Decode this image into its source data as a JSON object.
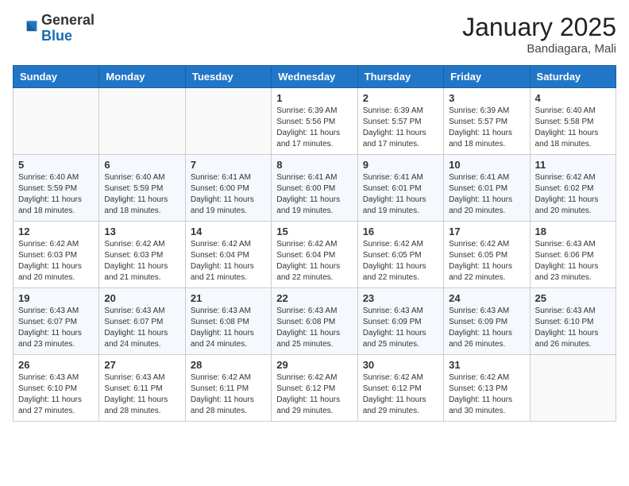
{
  "header": {
    "logo_general": "General",
    "logo_blue": "Blue",
    "month_title": "January 2025",
    "location": "Bandiagara, Mali"
  },
  "weekdays": [
    "Sunday",
    "Monday",
    "Tuesday",
    "Wednesday",
    "Thursday",
    "Friday",
    "Saturday"
  ],
  "weeks": [
    [
      {
        "day": "",
        "info": ""
      },
      {
        "day": "",
        "info": ""
      },
      {
        "day": "",
        "info": ""
      },
      {
        "day": "1",
        "info": "Sunrise: 6:39 AM\nSunset: 5:56 PM\nDaylight: 11 hours and 17 minutes."
      },
      {
        "day": "2",
        "info": "Sunrise: 6:39 AM\nSunset: 5:57 PM\nDaylight: 11 hours and 17 minutes."
      },
      {
        "day": "3",
        "info": "Sunrise: 6:39 AM\nSunset: 5:57 PM\nDaylight: 11 hours and 18 minutes."
      },
      {
        "day": "4",
        "info": "Sunrise: 6:40 AM\nSunset: 5:58 PM\nDaylight: 11 hours and 18 minutes."
      }
    ],
    [
      {
        "day": "5",
        "info": "Sunrise: 6:40 AM\nSunset: 5:59 PM\nDaylight: 11 hours and 18 minutes."
      },
      {
        "day": "6",
        "info": "Sunrise: 6:40 AM\nSunset: 5:59 PM\nDaylight: 11 hours and 18 minutes."
      },
      {
        "day": "7",
        "info": "Sunrise: 6:41 AM\nSunset: 6:00 PM\nDaylight: 11 hours and 19 minutes."
      },
      {
        "day": "8",
        "info": "Sunrise: 6:41 AM\nSunset: 6:00 PM\nDaylight: 11 hours and 19 minutes."
      },
      {
        "day": "9",
        "info": "Sunrise: 6:41 AM\nSunset: 6:01 PM\nDaylight: 11 hours and 19 minutes."
      },
      {
        "day": "10",
        "info": "Sunrise: 6:41 AM\nSunset: 6:01 PM\nDaylight: 11 hours and 20 minutes."
      },
      {
        "day": "11",
        "info": "Sunrise: 6:42 AM\nSunset: 6:02 PM\nDaylight: 11 hours and 20 minutes."
      }
    ],
    [
      {
        "day": "12",
        "info": "Sunrise: 6:42 AM\nSunset: 6:03 PM\nDaylight: 11 hours and 20 minutes."
      },
      {
        "day": "13",
        "info": "Sunrise: 6:42 AM\nSunset: 6:03 PM\nDaylight: 11 hours and 21 minutes."
      },
      {
        "day": "14",
        "info": "Sunrise: 6:42 AM\nSunset: 6:04 PM\nDaylight: 11 hours and 21 minutes."
      },
      {
        "day": "15",
        "info": "Sunrise: 6:42 AM\nSunset: 6:04 PM\nDaylight: 11 hours and 22 minutes."
      },
      {
        "day": "16",
        "info": "Sunrise: 6:42 AM\nSunset: 6:05 PM\nDaylight: 11 hours and 22 minutes."
      },
      {
        "day": "17",
        "info": "Sunrise: 6:42 AM\nSunset: 6:05 PM\nDaylight: 11 hours and 22 minutes."
      },
      {
        "day": "18",
        "info": "Sunrise: 6:43 AM\nSunset: 6:06 PM\nDaylight: 11 hours and 23 minutes."
      }
    ],
    [
      {
        "day": "19",
        "info": "Sunrise: 6:43 AM\nSunset: 6:07 PM\nDaylight: 11 hours and 23 minutes."
      },
      {
        "day": "20",
        "info": "Sunrise: 6:43 AM\nSunset: 6:07 PM\nDaylight: 11 hours and 24 minutes."
      },
      {
        "day": "21",
        "info": "Sunrise: 6:43 AM\nSunset: 6:08 PM\nDaylight: 11 hours and 24 minutes."
      },
      {
        "day": "22",
        "info": "Sunrise: 6:43 AM\nSunset: 6:08 PM\nDaylight: 11 hours and 25 minutes."
      },
      {
        "day": "23",
        "info": "Sunrise: 6:43 AM\nSunset: 6:09 PM\nDaylight: 11 hours and 25 minutes."
      },
      {
        "day": "24",
        "info": "Sunrise: 6:43 AM\nSunset: 6:09 PM\nDaylight: 11 hours and 26 minutes."
      },
      {
        "day": "25",
        "info": "Sunrise: 6:43 AM\nSunset: 6:10 PM\nDaylight: 11 hours and 26 minutes."
      }
    ],
    [
      {
        "day": "26",
        "info": "Sunrise: 6:43 AM\nSunset: 6:10 PM\nDaylight: 11 hours and 27 minutes."
      },
      {
        "day": "27",
        "info": "Sunrise: 6:43 AM\nSunset: 6:11 PM\nDaylight: 11 hours and 28 minutes."
      },
      {
        "day": "28",
        "info": "Sunrise: 6:42 AM\nSunset: 6:11 PM\nDaylight: 11 hours and 28 minutes."
      },
      {
        "day": "29",
        "info": "Sunrise: 6:42 AM\nSunset: 6:12 PM\nDaylight: 11 hours and 29 minutes."
      },
      {
        "day": "30",
        "info": "Sunrise: 6:42 AM\nSunset: 6:12 PM\nDaylight: 11 hours and 29 minutes."
      },
      {
        "day": "31",
        "info": "Sunrise: 6:42 AM\nSunset: 6:13 PM\nDaylight: 11 hours and 30 minutes."
      },
      {
        "day": "",
        "info": ""
      }
    ]
  ]
}
